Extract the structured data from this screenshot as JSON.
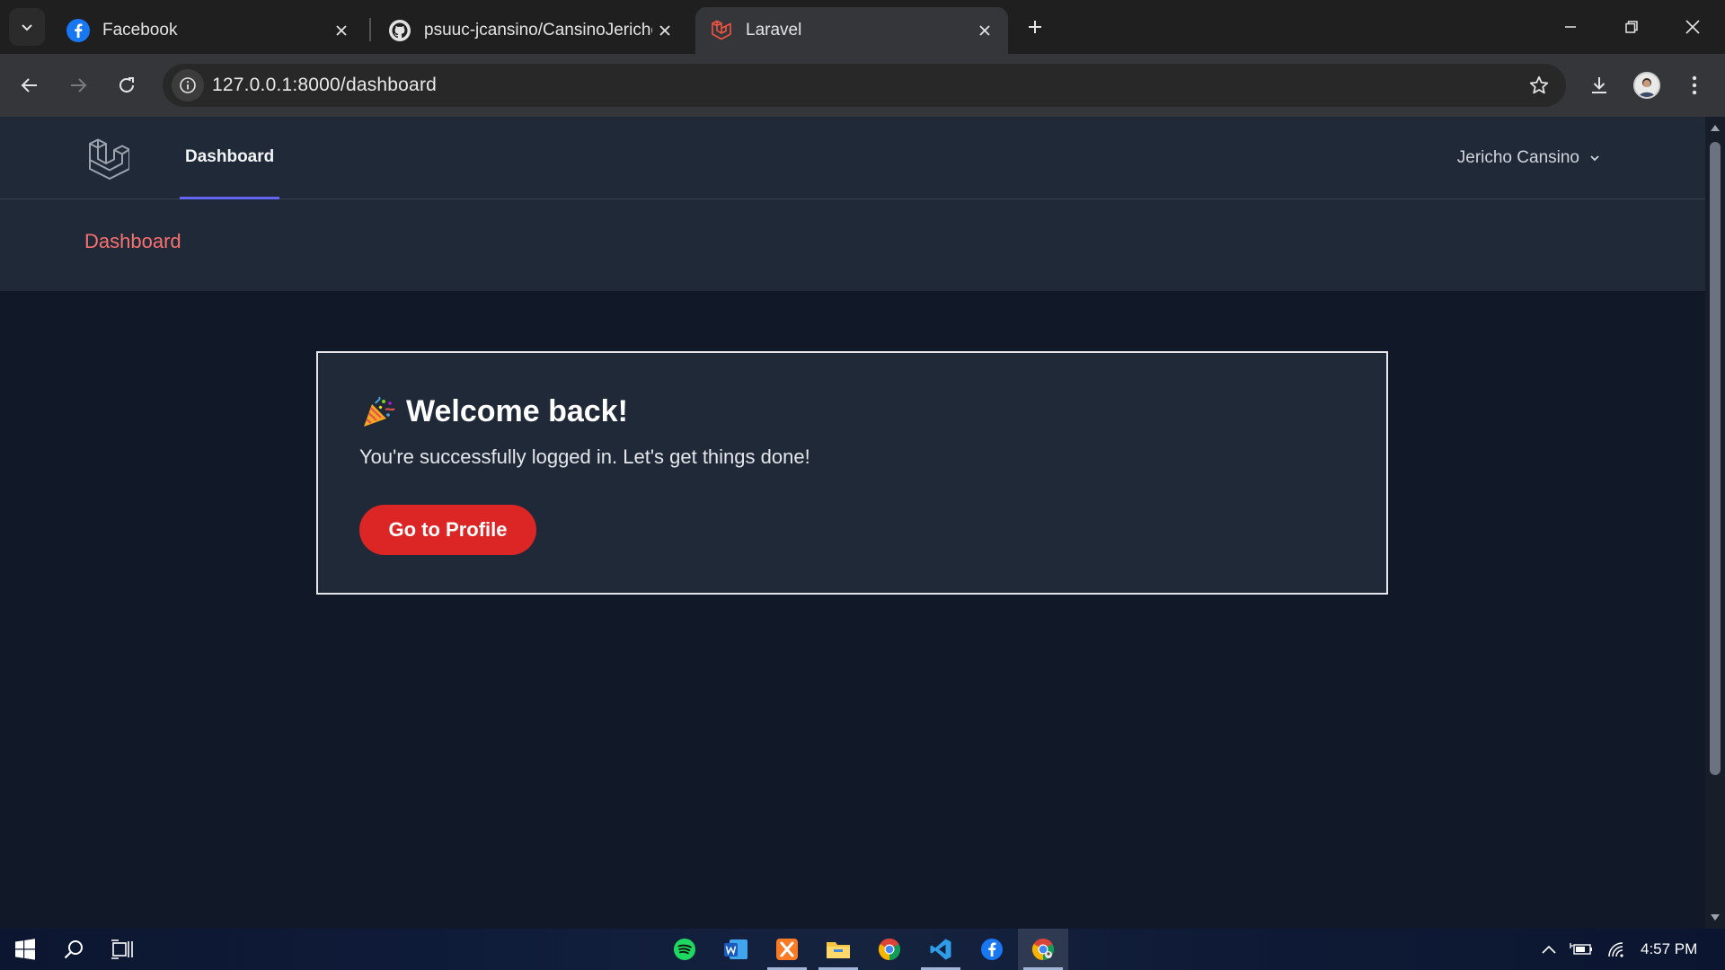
{
  "browser": {
    "tabs": [
      {
        "title": "Facebook",
        "icon": "facebook-icon",
        "active": false
      },
      {
        "title": "psuuc-jcansino/CansinoJericho",
        "icon": "github-icon",
        "active": false
      },
      {
        "title": "Laravel",
        "icon": "laravel-icon",
        "active": true
      }
    ],
    "url": "127.0.0.1:8000/dashboard"
  },
  "app": {
    "nav": {
      "dashboard_link": "Dashboard",
      "user_name": "Jericho Cansino"
    },
    "header": {
      "title": "Dashboard"
    },
    "card": {
      "emoji": "🎉",
      "heading": "Welcome back!",
      "message": "You're successfully logged in. Let's get things done!",
      "button_label": "Go to Profile"
    }
  },
  "taskbar": {
    "apps": [
      "spotify-icon",
      "word-icon",
      "xampp-icon",
      "file-explorer-icon",
      "chrome-icon",
      "vscode-icon",
      "facebook-icon",
      "chrome-icon"
    ],
    "clock": "4:57 PM"
  },
  "colors": {
    "page_bg": "#111827",
    "panel_bg": "#1f2937",
    "accent_red": "#dc2626",
    "header_title": "#f87171",
    "nav_indicator": "#6366f1"
  }
}
